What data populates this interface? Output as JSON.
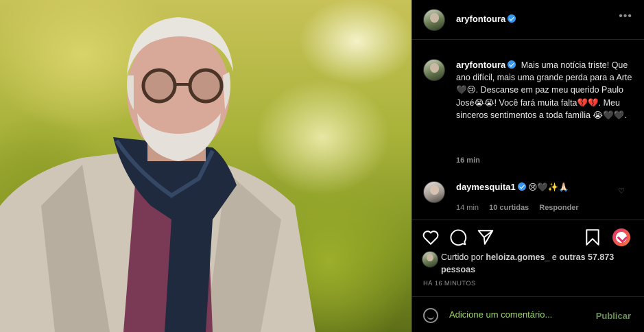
{
  "header": {
    "username": "aryfontoura",
    "more_label": "•••"
  },
  "caption": {
    "username": "aryfontoura",
    "text": "Mais uma notícia triste! Que ano difícil, mais uma grande perda para a Arte🖤😢. Descanse em paz meu querido Paulo José😭😭! Você fará muita falta💔💔. Meu sinceros sentimentos a toda família 😭🖤🖤.",
    "time": "16 min"
  },
  "reply": {
    "username": "daymesquita1",
    "text": "😢🖤✨🙏🏻",
    "time": "14 min",
    "likes": "10 curtidas",
    "reply_label": "Responder"
  },
  "liked_by": {
    "prefix": "Curtido por",
    "user": "heloiza.gomes_",
    "conj": "e",
    "others": "outras 57.873 pessoas"
  },
  "timeago": "HÁ 16 MINUTOS",
  "comment": {
    "placeholder": "Adicione um comentário...",
    "publish_label": "Publicar"
  },
  "colors": {
    "verified": "#3897f0",
    "background": "#000000",
    "input_text": "#9ad66a"
  }
}
